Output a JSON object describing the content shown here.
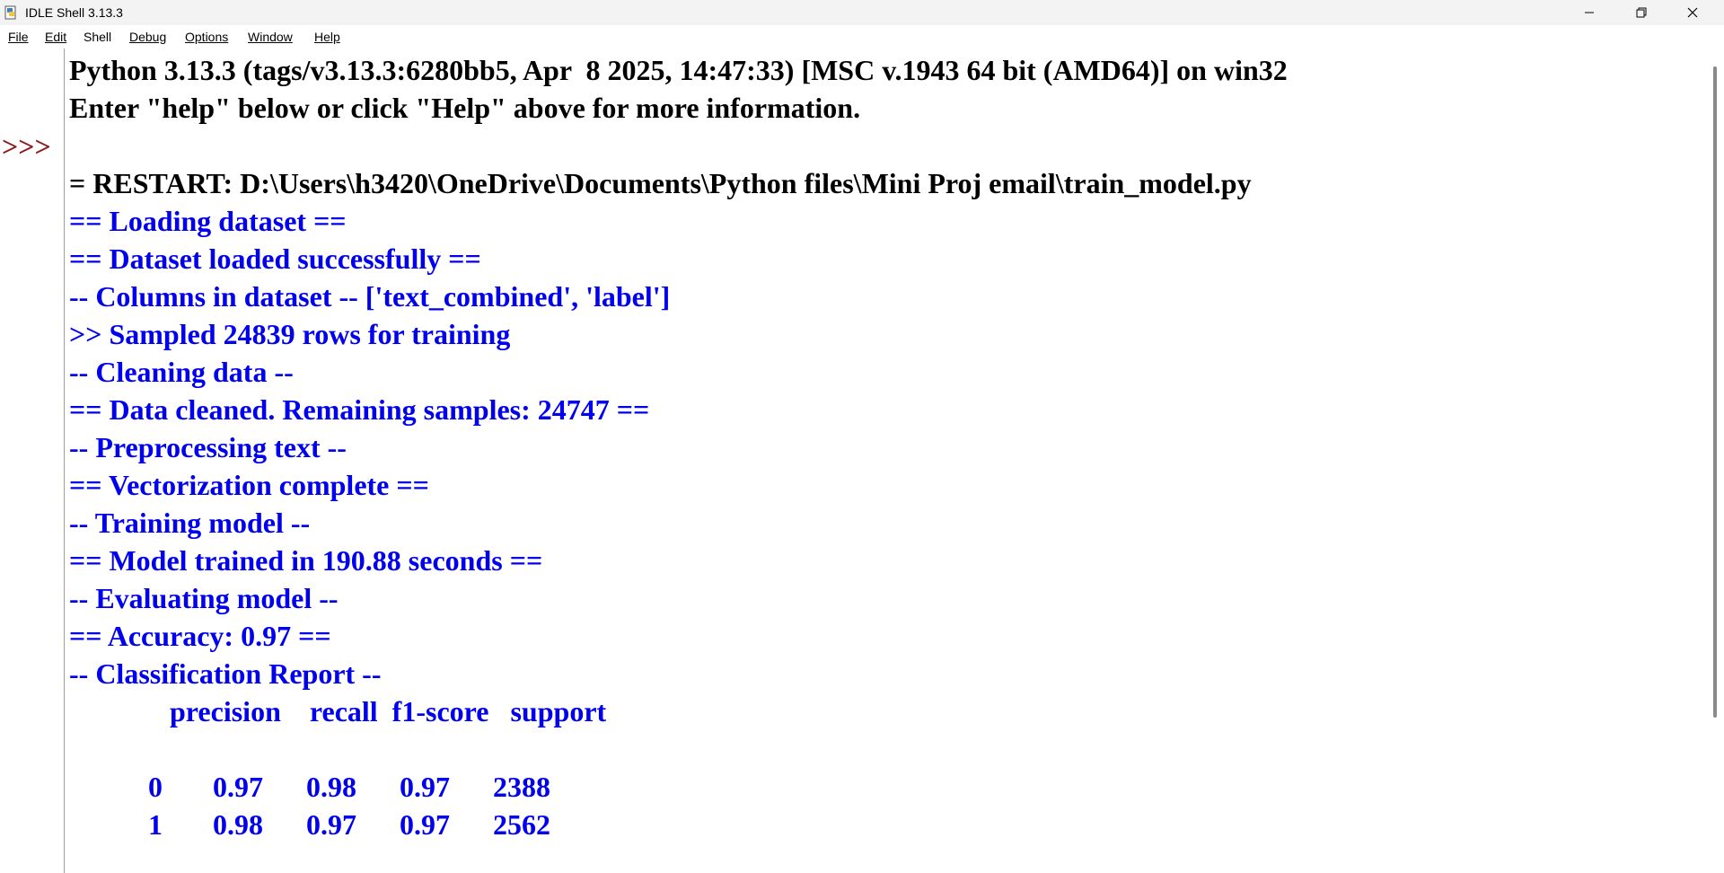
{
  "window": {
    "title": "IDLE Shell 3.13.3",
    "app_icon": "idle-python-icon",
    "controls": [
      "minimize-icon",
      "restore-icon",
      "close-icon"
    ]
  },
  "menu": {
    "items": [
      {
        "label": "File"
      },
      {
        "label": "Edit"
      },
      {
        "label": "Shell"
      },
      {
        "label": "Debug"
      },
      {
        "label": "Options"
      },
      {
        "label": "Window"
      },
      {
        "label": "Help"
      }
    ]
  },
  "shell": {
    "prompt": ">>>",
    "header": [
      "Python 3.13.3 (tags/v3.13.3:6280bb5, Apr  8 2025, 14:47:33) [MSC v.1943 64 bit (AMD64)] on win32",
      "Enter \"help\" below or click \"Help\" above for more information."
    ],
    "restart": "= RESTART: D:\\Users\\h3420\\OneDrive\\Documents\\Python files\\Mini Proj email\\train_model.py",
    "output": [
      "== Loading dataset ==",
      "== Dataset loaded successfully ==",
      "-- Columns in dataset -- ['text_combined', 'label']",
      ">> Sampled 24839 rows for training",
      "-- Cleaning data --",
      "== Data cleaned. Remaining samples: 24747 ==",
      "-- Preprocessing text --",
      "== Vectorization complete ==",
      "-- Training model --",
      "== Model trained in 190.88 seconds ==",
      "-- Evaluating model --",
      "== Accuracy: 0.97 ==",
      "-- Classification Report --",
      "              precision    recall  f1-score   support",
      "",
      "           0       0.97      0.98      0.97      2388",
      "           1       0.98      0.97      0.97      2562"
    ]
  },
  "colors": {
    "stdout": "#0000ee",
    "text": "#000000",
    "prompt": "#8b1a1a"
  }
}
